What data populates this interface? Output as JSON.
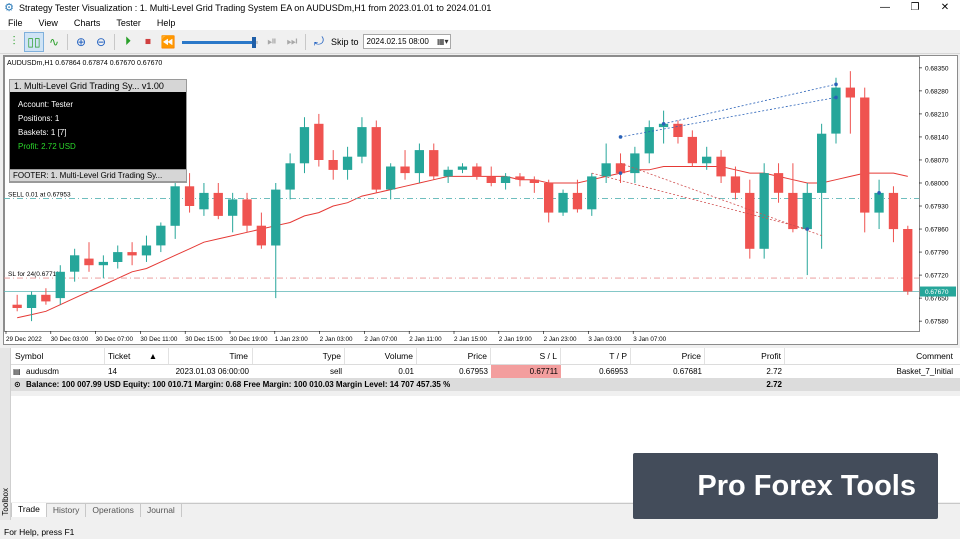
{
  "window": {
    "title": "Strategy Tester Visualization : 1. Multi-Level Grid Trading System EA on AUDUSDm,H1 from 2023.01.01 to 2024.01.01",
    "controls": [
      "—",
      "❐",
      "✕"
    ]
  },
  "menu": [
    "File",
    "View",
    "Charts",
    "Tester",
    "Help"
  ],
  "toolbar": {
    "skip_label": "Skip to",
    "skip_date": "2024.02.15 08:00",
    "speed": 0.95
  },
  "chart": {
    "header": "AUDUSDm,H1  0.67864 0.67874 0.67670 0.67670",
    "sell_label": "SELL 0.01 at 0.67953",
    "sl_label": "SL for 24(0.67711)",
    "y_ticks": [
      "0.68350",
      "0.68280",
      "0.68210",
      "0.68140",
      "0.68070",
      "0.68000",
      "0.67930",
      "0.67860",
      "0.67790",
      "0.67720",
      "0.67650",
      "0.67580"
    ],
    "current_price": "0.67670",
    "x_ticks": [
      "29 Dec 2022",
      "30 Dec 03:00",
      "30 Dec 07:00",
      "30 Dec 11:00",
      "30 Dec 15:00",
      "30 Dec 19:00",
      "1 Jan 23:00",
      "2 Jan 03:00",
      "2 Jan 07:00",
      "2 Jan 11:00",
      "2 Jan 15:00",
      "2 Jan 19:00",
      "2 Jan 23:00",
      "3 Jan 03:00",
      "3 Jan 07:00"
    ]
  },
  "chart_data": {
    "type": "candlestick",
    "ylim": [
      0.6755,
      0.6838
    ],
    "candles": [
      [
        0.6763,
        0.6766,
        0.6761,
        0.6762
      ],
      [
        0.6762,
        0.6767,
        0.6758,
        0.6766
      ],
      [
        0.6766,
        0.6768,
        0.6763,
        0.6764
      ],
      [
        0.6765,
        0.6775,
        0.6763,
        0.6773
      ],
      [
        0.6773,
        0.678,
        0.677,
        0.6778
      ],
      [
        0.6777,
        0.6782,
        0.6773,
        0.6775
      ],
      [
        0.6775,
        0.6778,
        0.6771,
        0.6776
      ],
      [
        0.6776,
        0.6781,
        0.6774,
        0.6779
      ],
      [
        0.6779,
        0.6782,
        0.6775,
        0.6778
      ],
      [
        0.6778,
        0.6784,
        0.6776,
        0.6781
      ],
      [
        0.6781,
        0.6788,
        0.6779,
        0.6787
      ],
      [
        0.6787,
        0.6801,
        0.6783,
        0.6799
      ],
      [
        0.6799,
        0.6803,
        0.6791,
        0.6793
      ],
      [
        0.6792,
        0.68,
        0.679,
        0.6797
      ],
      [
        0.6797,
        0.68,
        0.6789,
        0.679
      ],
      [
        0.679,
        0.6797,
        0.6785,
        0.6795
      ],
      [
        0.6795,
        0.6797,
        0.6785,
        0.6787
      ],
      [
        0.6787,
        0.6791,
        0.678,
        0.6781
      ],
      [
        0.6781,
        0.68,
        0.6765,
        0.6798
      ],
      [
        0.6798,
        0.6809,
        0.6795,
        0.6806
      ],
      [
        0.6806,
        0.682,
        0.6803,
        0.6817
      ],
      [
        0.6818,
        0.6821,
        0.6805,
        0.6807
      ],
      [
        0.6807,
        0.681,
        0.6801,
        0.6804
      ],
      [
        0.6804,
        0.6811,
        0.6801,
        0.6808
      ],
      [
        0.6808,
        0.682,
        0.6806,
        0.6817
      ],
      [
        0.6817,
        0.6819,
        0.6797,
        0.6798
      ],
      [
        0.6798,
        0.6806,
        0.6795,
        0.6805
      ],
      [
        0.6805,
        0.681,
        0.6801,
        0.6803
      ],
      [
        0.6803,
        0.6812,
        0.68,
        0.681
      ],
      [
        0.681,
        0.6812,
        0.6801,
        0.6802
      ],
      [
        0.6802,
        0.6805,
        0.68,
        0.6804
      ],
      [
        0.6804,
        0.6806,
        0.6803,
        0.6805
      ],
      [
        0.6805,
        0.6806,
        0.6801,
        0.6802
      ],
      [
        0.6802,
        0.6805,
        0.6799,
        0.68
      ],
      [
        0.68,
        0.6803,
        0.6798,
        0.6802
      ],
      [
        0.6802,
        0.6803,
        0.6799,
        0.6801
      ],
      [
        0.6801,
        0.6802,
        0.6797,
        0.68
      ],
      [
        0.68,
        0.6801,
        0.6788,
        0.6791
      ],
      [
        0.6791,
        0.6798,
        0.679,
        0.6797
      ],
      [
        0.6797,
        0.6801,
        0.6791,
        0.6792
      ],
      [
        0.6792,
        0.6803,
        0.679,
        0.6802
      ],
      [
        0.6802,
        0.6812,
        0.68,
        0.6806
      ],
      [
        0.6806,
        0.6809,
        0.68,
        0.6803
      ],
      [
        0.6803,
        0.6811,
        0.68,
        0.6809
      ],
      [
        0.6809,
        0.6819,
        0.6806,
        0.6817
      ],
      [
        0.6817,
        0.6822,
        0.6812,
        0.6818
      ],
      [
        0.6818,
        0.6819,
        0.6812,
        0.6814
      ],
      [
        0.6814,
        0.6816,
        0.6805,
        0.6806
      ],
      [
        0.6806,
        0.6811,
        0.6804,
        0.6808
      ],
      [
        0.6808,
        0.681,
        0.68,
        0.6802
      ],
      [
        0.6802,
        0.6805,
        0.6795,
        0.6797
      ],
      [
        0.6797,
        0.6801,
        0.6777,
        0.678
      ],
      [
        0.678,
        0.6806,
        0.6777,
        0.6803
      ],
      [
        0.6803,
        0.6806,
        0.6794,
        0.6797
      ],
      [
        0.6797,
        0.6806,
        0.6785,
        0.6786
      ],
      [
        0.6786,
        0.68,
        0.6772,
        0.6797
      ],
      [
        0.6797,
        0.6818,
        0.678,
        0.6815
      ],
      [
        0.6815,
        0.6832,
        0.6812,
        0.6829
      ],
      [
        0.6829,
        0.6834,
        0.6815,
        0.6826
      ],
      [
        0.6826,
        0.6829,
        0.6785,
        0.6791
      ],
      [
        0.6791,
        0.6801,
        0.6786,
        0.6797
      ],
      [
        0.6797,
        0.6799,
        0.6782,
        0.6786
      ],
      [
        0.6786,
        0.6787,
        0.6766,
        0.6767
      ]
    ],
    "ma": [
      0.6759,
      0.676,
      0.6761,
      0.6763,
      0.6765,
      0.6767,
      0.6769,
      0.6771,
      0.6773,
      0.6774,
      0.6776,
      0.6778,
      0.678,
      0.6782,
      0.6783,
      0.6784,
      0.6785,
      0.6786,
      0.6787,
      0.6788,
      0.679,
      0.6791,
      0.6793,
      0.6794,
      0.6796,
      0.6797,
      0.6798,
      0.6799,
      0.68,
      0.6801,
      0.6802,
      0.6802,
      0.6802,
      0.6802,
      0.6802,
      0.6801,
      0.6801,
      0.68,
      0.68,
      0.68,
      0.6801,
      0.6802,
      0.6803,
      0.6804,
      0.6804,
      0.6805,
      0.6805,
      0.6805,
      0.6805,
      0.6805,
      0.6804,
      0.6803,
      0.6803,
      0.6802,
      0.6801,
      0.68,
      0.68,
      0.6801,
      0.6802,
      0.6803,
      0.6803,
      0.6803,
      0.6802
    ]
  },
  "ea_panel": {
    "title": "1. Multi-Level Grid Trading Sy...  v1.00",
    "account": "Account: Tester",
    "positions": "Positions: 1",
    "baskets": "Baskets: 1 [7]",
    "profit": "Profit: 2.72 USD",
    "footer": "FOOTER: 1. Multi-Level Grid Trading Sy..."
  },
  "table": {
    "columns": [
      "Symbol",
      "Ticket",
      "Time",
      "Type",
      "Volume",
      "Price",
      "S / L",
      "T / P",
      "Price",
      "Profit",
      "Comment"
    ],
    "rows": [
      {
        "symbol": "audusdm",
        "ticket": "14",
        "time": "2023.01.03 06:00:00",
        "type": "sell",
        "volume": "0.01",
        "price": "0.67953",
        "sl": "0.67711",
        "tp": "0.66953",
        "price2": "0.67681",
        "profit": "2.72",
        "comment": "Basket_7_Initial"
      }
    ],
    "summary": "Balance: 100 007.99 USD  Equity: 100 010.71  Margin: 0.68  Free Margin: 100 010.03  Margin Level: 14 707 457.35 %",
    "summary_profit": "2.72"
  },
  "tabs": [
    "Trade",
    "History",
    "Operations",
    "Journal"
  ],
  "toolbox_label": "Toolbox",
  "status": "For Help, press F1",
  "watermark": "Pro Forex Tools",
  "colors": {
    "bull": "#26a69a",
    "bear": "#ef5350",
    "ma": "#e53935"
  }
}
